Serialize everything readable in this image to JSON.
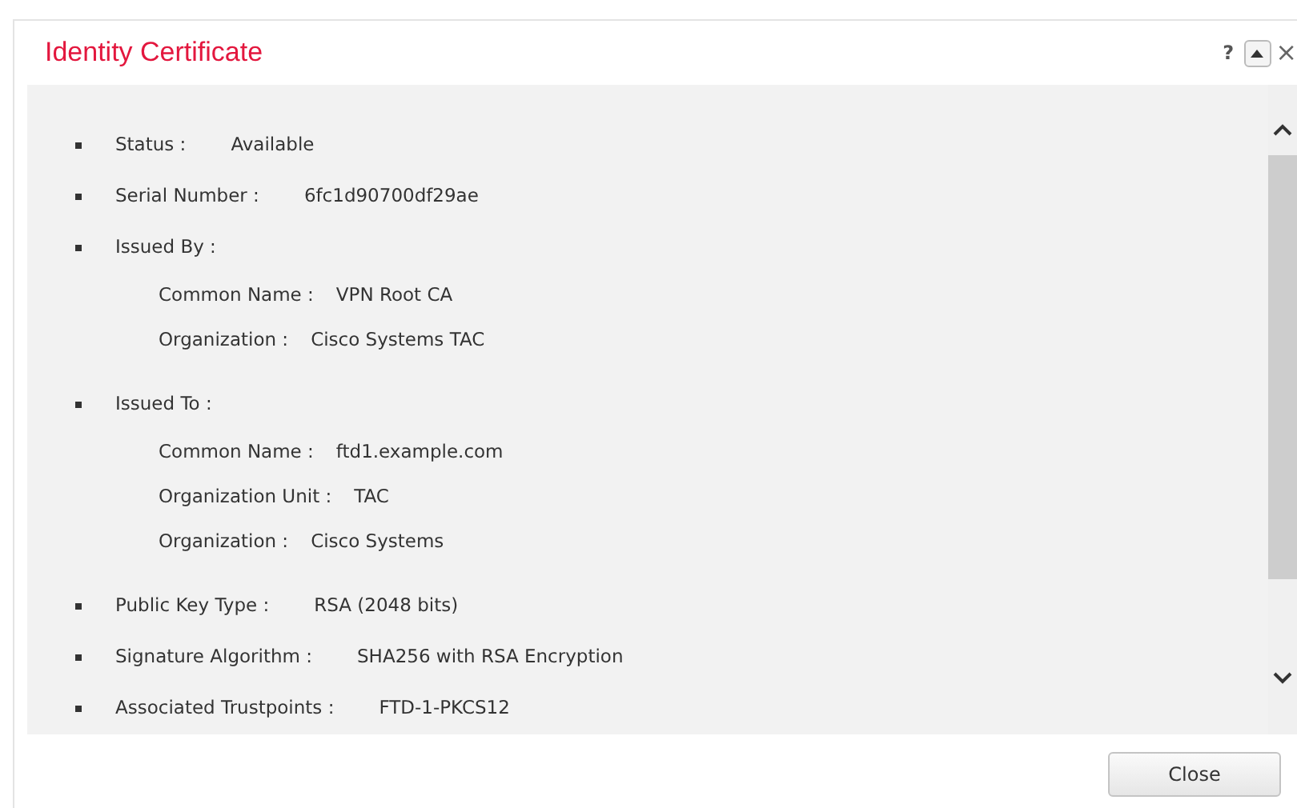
{
  "dialog": {
    "title": "Identity Certificate",
    "help": "?",
    "close_glyph": "×",
    "details": [
      {
        "label": "Status :",
        "value": "Available"
      },
      {
        "label": "Serial Number :",
        "value": "6fc1d90700df29ae"
      },
      {
        "label": "Issued By :",
        "children": [
          {
            "label": "Common Name :",
            "value": "VPN Root CA"
          },
          {
            "label": "Organization :",
            "value": "Cisco Systems TAC"
          }
        ]
      },
      {
        "label": "Issued To :",
        "children": [
          {
            "label": "Common Name :",
            "value": "ftd1.example.com"
          },
          {
            "label": "Organization Unit :",
            "value": "TAC"
          },
          {
            "label": "Organization :",
            "value": "Cisco Systems"
          }
        ]
      },
      {
        "label": "Public Key Type :",
        "value": "RSA (2048 bits)"
      },
      {
        "label": "Signature Algorithm :",
        "value": "SHA256 with RSA Encryption"
      },
      {
        "label": "Associated Trustpoints :",
        "value": "FTD-1-PKCS12"
      }
    ],
    "buttons": [
      {
        "label": "Close"
      }
    ]
  }
}
